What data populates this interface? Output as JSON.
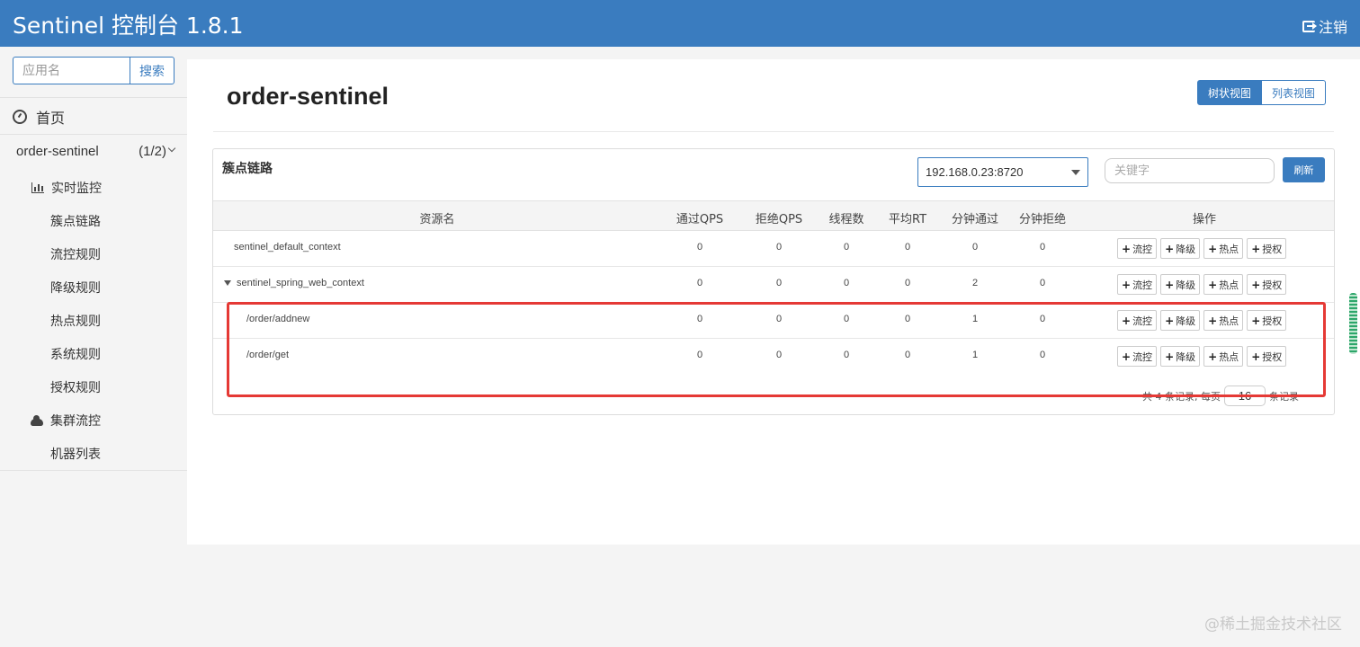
{
  "header": {
    "brand": "Sentinel 控制台 1.8.1",
    "logout": "注销"
  },
  "sidebar": {
    "search_placeholder": "应用名",
    "search_button": "搜索",
    "home": "首页",
    "app_name": "order-sentinel",
    "app_count": "(1/2)",
    "menu": {
      "realtime": "实时监控",
      "cluster_link": "簇点链路",
      "flow_rules": "流控规则",
      "degrade_rules": "降级规则",
      "hotspot_rules": "热点规则",
      "system_rules": "系统规则",
      "auth_rules": "授权规则",
      "cluster_flow": "集群流控",
      "machine_list": "机器列表"
    }
  },
  "main": {
    "title": "order-sentinel",
    "view_tree": "树状视图",
    "view_list": "列表视图",
    "panel_title": "簇点链路",
    "machine": "192.168.0.23:8720",
    "keyword_placeholder": "关键字",
    "refresh": "刷新",
    "columns": {
      "resource": "资源名",
      "pass_qps": "通过QPS",
      "block_qps": "拒绝QPS",
      "threads": "线程数",
      "avg_rt": "平均RT",
      "minute_pass": "分钟通过",
      "minute_block": "分钟拒绝",
      "actions": "操作"
    },
    "rows": [
      {
        "name": "sentinel_default_context",
        "pass_qps": "0",
        "block_qps": "0",
        "threads": "0",
        "avg_rt": "0",
        "minute_pass": "0",
        "minute_block": "0"
      },
      {
        "name": "sentinel_spring_web_context",
        "pass_qps": "0",
        "block_qps": "0",
        "threads": "0",
        "avg_rt": "0",
        "minute_pass": "2",
        "minute_block": "0"
      },
      {
        "name": "/order/addnew",
        "pass_qps": "0",
        "block_qps": "0",
        "threads": "0",
        "avg_rt": "0",
        "minute_pass": "1",
        "minute_block": "0"
      },
      {
        "name": "/order/get",
        "pass_qps": "0",
        "block_qps": "0",
        "threads": "0",
        "avg_rt": "0",
        "minute_pass": "1",
        "minute_block": "0"
      }
    ],
    "ops": {
      "flow": "流控",
      "degrade": "降级",
      "hotspot": "热点",
      "auth": "授权"
    },
    "pager": {
      "prefix": "共 4 条记录, 每页",
      "page_size": "16",
      "suffix": "条记录"
    }
  },
  "watermark": "@稀土掘金技术社区"
}
